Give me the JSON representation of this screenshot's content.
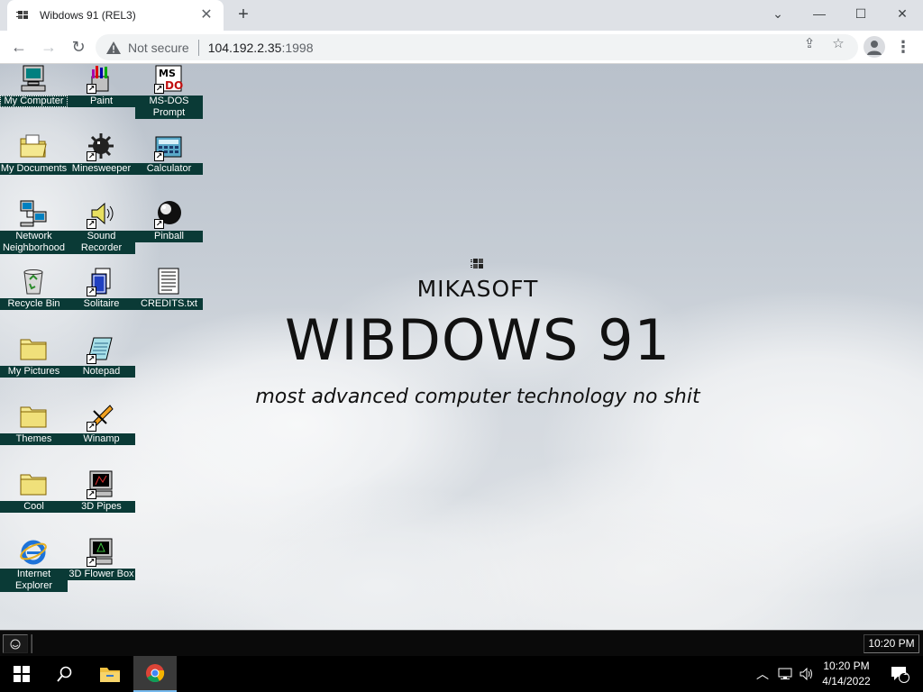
{
  "browser": {
    "tab_title": "Wibdows 91 (REL3)",
    "new_tab": "+",
    "controls": {
      "minimize": "—",
      "maximize": "☐",
      "close": "✕",
      "tabs_menu": "⌄"
    },
    "nav": {
      "back": "←",
      "forward": "→",
      "reload": "↻"
    },
    "security": "Not secure",
    "url_host": "104.192.2.35",
    "url_port": ":1998",
    "share": "⇪",
    "bookmark": "☆",
    "menu": "⋮"
  },
  "desktop": {
    "icons": [
      {
        "label": "My Computer",
        "icon": "computer-icon",
        "shortcut": false
      },
      {
        "label": "Paint",
        "icon": "paint-icon",
        "shortcut": true
      },
      {
        "label": "MS-DOS Prompt",
        "icon": "msdos-icon",
        "shortcut": true
      },
      {
        "label": "My Documents",
        "icon": "folder-open-icon",
        "shortcut": false
      },
      {
        "label": "Minesweeper",
        "icon": "mine-icon",
        "shortcut": true
      },
      {
        "label": "Calculator",
        "icon": "calculator-icon",
        "shortcut": true
      },
      {
        "label": "Network Neighborhood",
        "icon": "network-icon",
        "shortcut": false
      },
      {
        "label": "Sound Recorder",
        "icon": "speaker-icon",
        "shortcut": true
      },
      {
        "label": "Pinball",
        "icon": "pinball-icon",
        "shortcut": true
      },
      {
        "label": "Recycle Bin",
        "icon": "recycle-bin-icon",
        "shortcut": false
      },
      {
        "label": "Solitaire",
        "icon": "cards-icon",
        "shortcut": true
      },
      {
        "label": "CREDITS.txt",
        "icon": "text-file-icon",
        "shortcut": false
      },
      {
        "label": "My Pictures",
        "icon": "folder-icon",
        "shortcut": false
      },
      {
        "label": "Notepad",
        "icon": "notepad-icon",
        "shortcut": true
      },
      {
        "label": "Themes",
        "icon": "folder-icon",
        "shortcut": false
      },
      {
        "label": "Winamp",
        "icon": "winamp-icon",
        "shortcut": true
      },
      {
        "label": "Cool",
        "icon": "folder-icon",
        "shortcut": false
      },
      {
        "label": "3D Pipes",
        "icon": "screensaver-icon",
        "shortcut": true
      },
      {
        "label": "Internet Explorer",
        "icon": "ie-icon",
        "shortcut": false
      },
      {
        "label": "3D Flower Box",
        "icon": "screensaver-icon",
        "shortcut": true
      }
    ],
    "splash": {
      "subtitle": "MIKASOFT",
      "title": "WIBDOWS 91",
      "tagline": "most advanced computer technology no shit"
    }
  },
  "wibdows_taskbar": {
    "clock": "10:20 PM"
  },
  "os_taskbar": {
    "time": "10:20 PM",
    "date": "4/14/2022",
    "notifications": "1"
  }
}
